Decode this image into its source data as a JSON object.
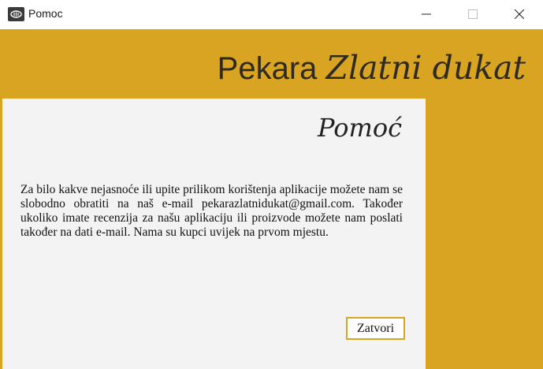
{
  "window": {
    "title": "Pomoc",
    "controls": {
      "minimize": "minimize-icon",
      "maximize": "maximize-icon",
      "close": "close-icon"
    }
  },
  "header": {
    "brand_plain": "Pekara ",
    "brand_script": "Zlatni dukat"
  },
  "panel": {
    "title": "Pomoć",
    "body": "Za bilo kakve nejasnoće ili upite prilikom korištenja aplikacije možete nam se slobodno obratiti na naš e-mail pekarazlatnidukat@gmail.com. Također ukoliko imate recenzija za našu aplikaciju ili proizvode možete nam poslati također na dati e-mail. Nama su kupci uvijek na prvom mjestu.",
    "close_label": "Zatvori"
  },
  "colors": {
    "accent": "#d9a421",
    "panel_bg": "#f3f3f3",
    "text": "#2e2a20"
  }
}
